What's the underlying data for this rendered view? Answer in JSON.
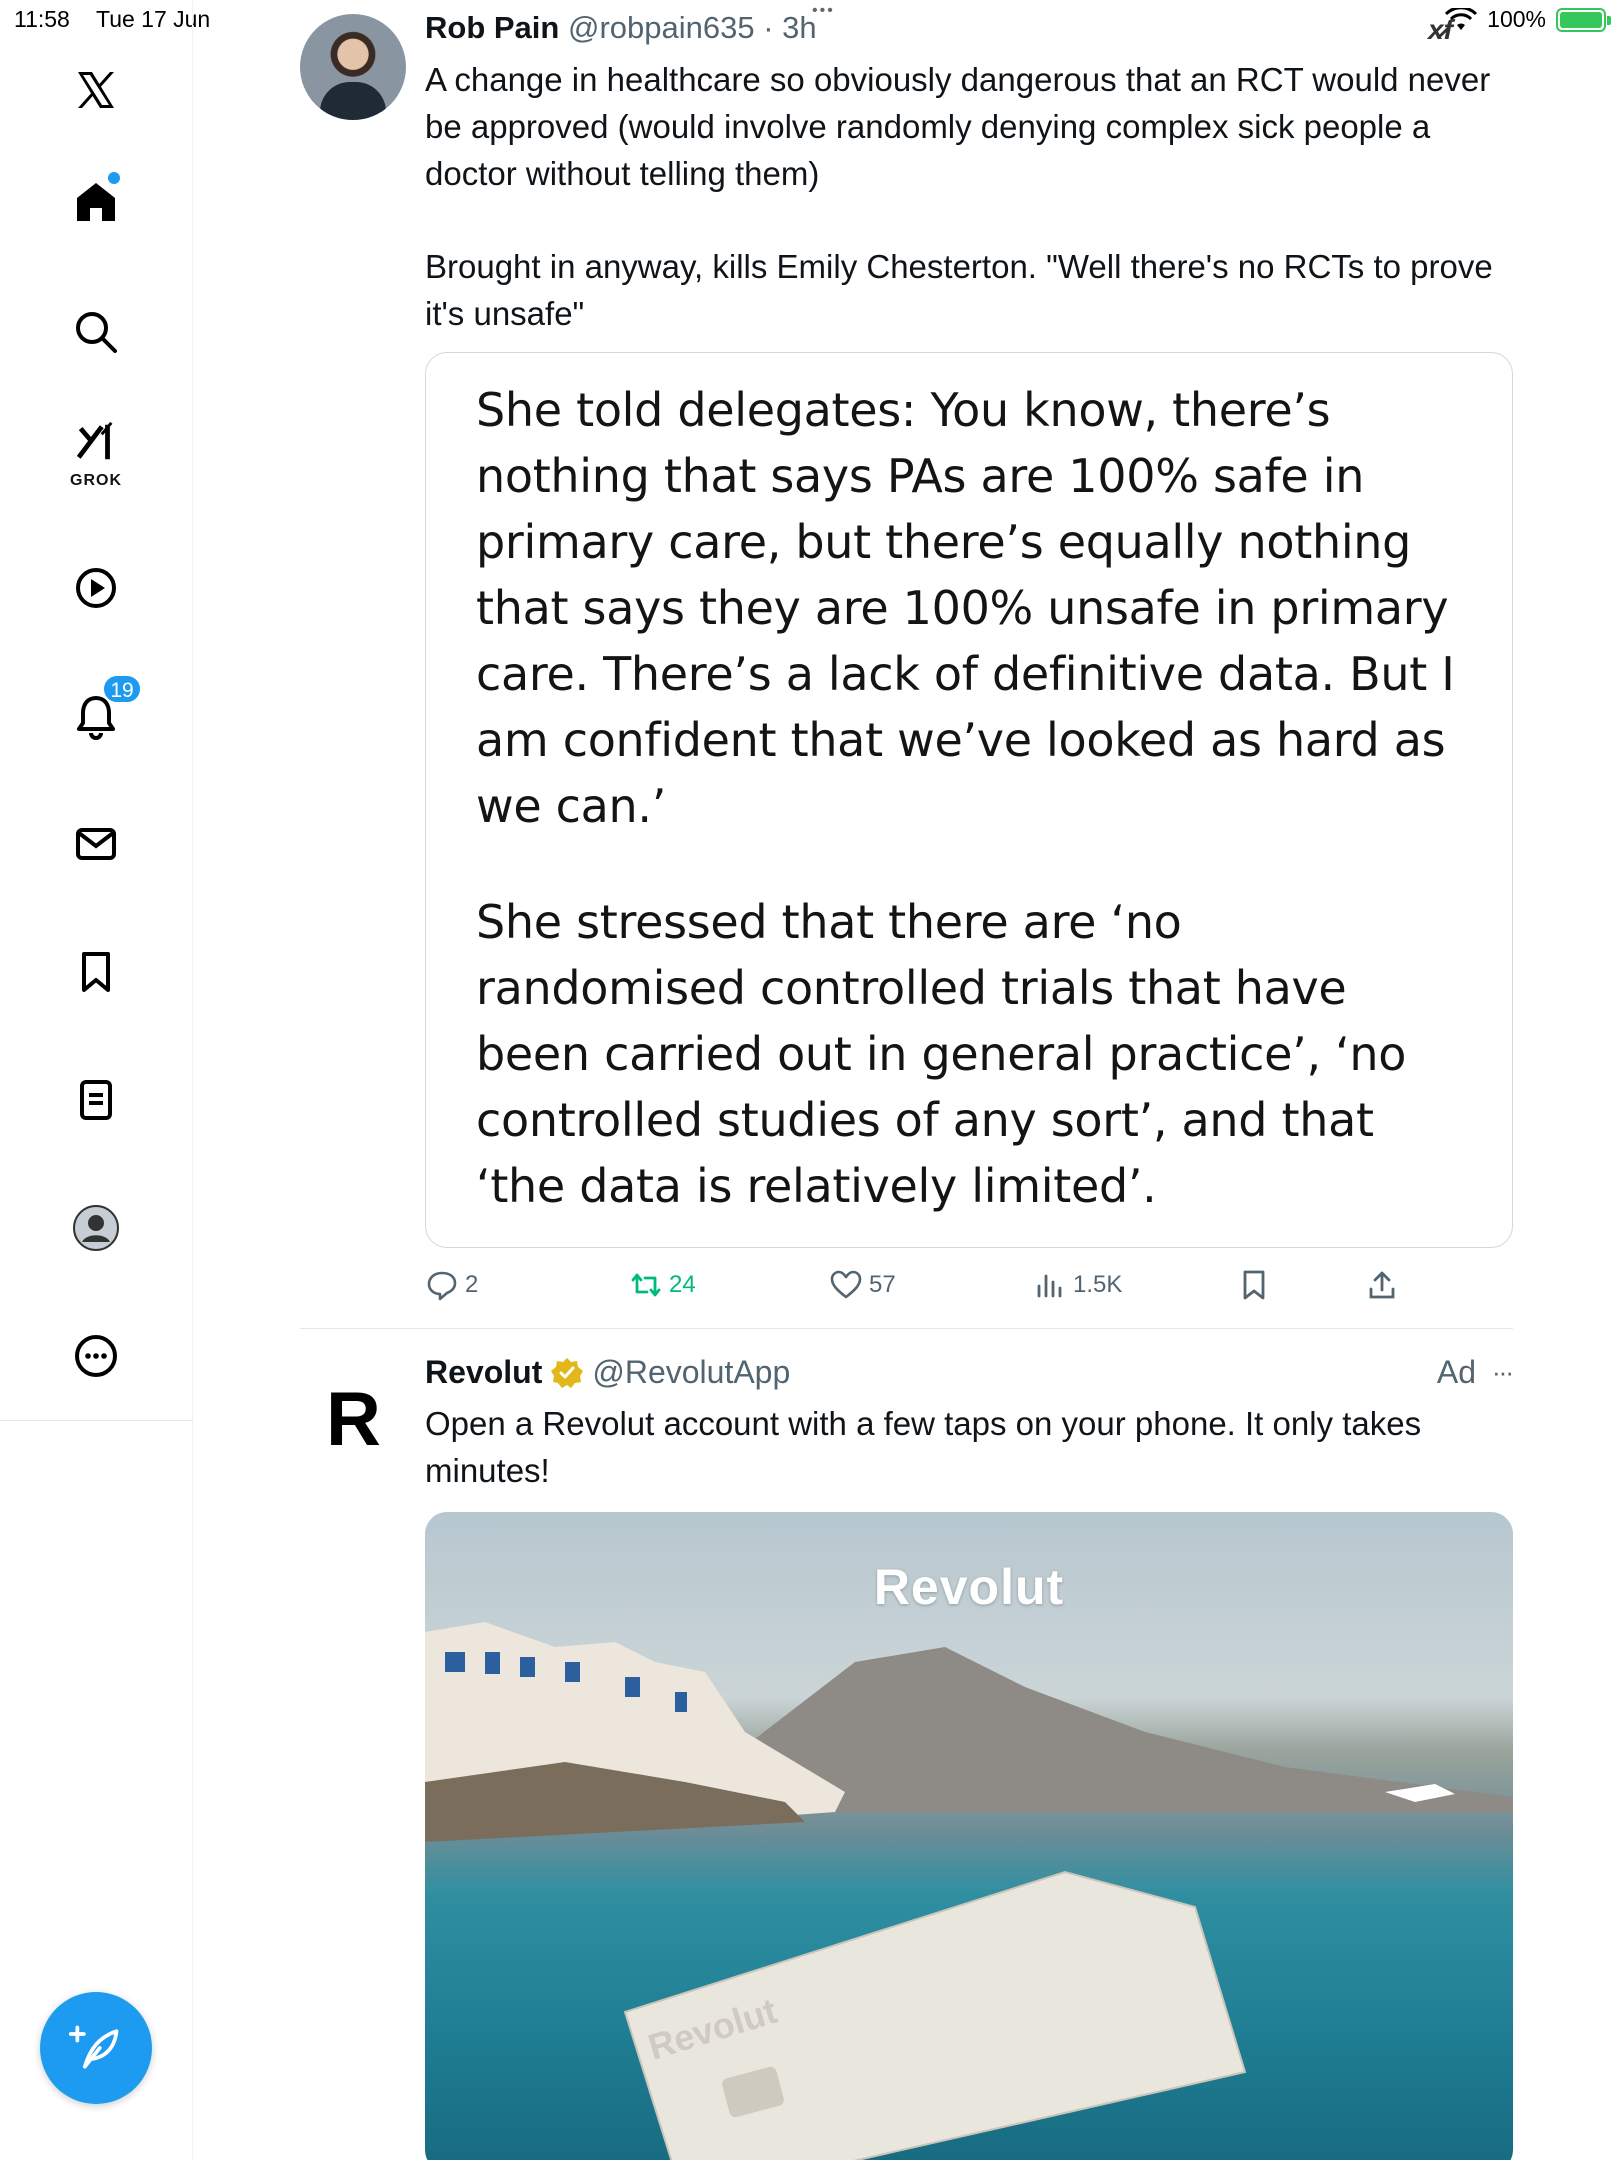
{
  "status_bar": {
    "time": "11:58",
    "date": "Tue 17 Jun",
    "battery_percent": "100%",
    "battery_level": 1.0
  },
  "sidebar": {
    "items": [
      {
        "name": "x-logo",
        "label": ""
      },
      {
        "name": "home",
        "label": ""
      },
      {
        "name": "search",
        "label": ""
      },
      {
        "name": "grok",
        "label": "GROK"
      },
      {
        "name": "video",
        "label": ""
      },
      {
        "name": "notifications",
        "label": ""
      },
      {
        "name": "messages",
        "label": ""
      },
      {
        "name": "bookmarks",
        "label": ""
      },
      {
        "name": "lists",
        "label": ""
      },
      {
        "name": "profile",
        "label": ""
      },
      {
        "name": "more",
        "label": ""
      }
    ],
    "notification_count": "19"
  },
  "tweet": {
    "author_name": "Rob Pain",
    "author_handle": "@robpain635",
    "time_ago": "3h",
    "text_p1": "A change in healthcare so obviously  dangerous that an RCT would never be approved (would involve randomly denying complex sick people a doctor without telling them)",
    "text_p2": "Brought in anyway, kills Emily Chesterton. \"Well there's no RCTs to prove it's unsafe\"",
    "quote_p1": "She told delegates: You know, there’s nothing that says PAs are 100% safe in primary care, but there’s equally nothing that says they are 100% unsafe in primary care. There’s a lack of definitive data. But I am confident that we’ve looked as hard as we can.’",
    "quote_p2": "She stressed that there are ‘no randomised controlled trials that have been carried out in general practice’, ‘no controlled studies of any sort’, and that ‘the data is relatively limited’.",
    "replies": "2",
    "reposts": "24",
    "likes": "57",
    "views": "1.5K"
  },
  "ad": {
    "name": "Revolut",
    "handle": "@RevolutApp",
    "tag": "Ad",
    "more": "···",
    "text": "Open a Revolut account with a few taps on your phone. It only takes minutes!",
    "logo_letter": "R",
    "media_brand": "Revolut",
    "card_brand": "Revolut"
  },
  "colors": {
    "accent": "#1d9bf0",
    "repost": "#00ba7c",
    "muted_text": "#536471",
    "verified": "#e2b719",
    "battery": "#34c759"
  }
}
